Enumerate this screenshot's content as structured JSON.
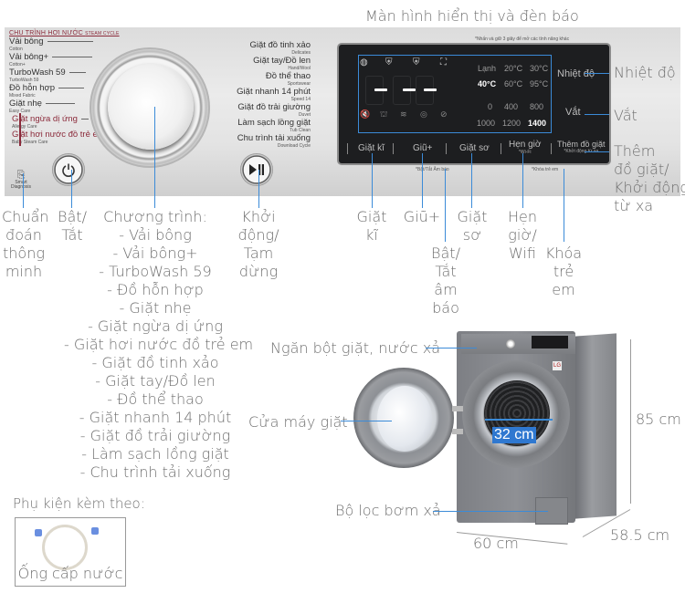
{
  "title_display": "Màn hình hiển thị và đèn báo",
  "panel": {
    "program_header": "CHU TRÌNH HƠI NƯỚC",
    "program_header_sub": "STEAM CYCLE",
    "left_programs": [
      {
        "name": "Vải bông",
        "sub": "Cotton",
        "style": "normal"
      },
      {
        "name": "Vải bông+",
        "sub": "Cotton+",
        "style": "normal"
      },
      {
        "name": "TurboWash 59",
        "sub": "TurboWash 59",
        "style": "normal"
      },
      {
        "name": "Đồ hỗn hợp",
        "sub": "Mixed Fabric",
        "style": "normal"
      },
      {
        "name": "Giặt nhẹ",
        "sub": "Easy Care",
        "style": "normal"
      },
      {
        "name": "Giặt ngừa dị ứng",
        "sub": "Allergy Care",
        "style": "red"
      },
      {
        "name": "Giặt hơi nước đồ trẻ em",
        "sub": "Baby Steam Care",
        "style": "red"
      }
    ],
    "right_programs": [
      {
        "name": "Giặt đồ tinh xảo",
        "sub": "Delicates"
      },
      {
        "name": "Giặt tay/Đồ len",
        "sub": "Hand/Wool"
      },
      {
        "name": "Đồ thể thao",
        "sub": "Sportswear"
      },
      {
        "name": "Giặt nhanh 14 phút",
        "sub": "Speed 14"
      },
      {
        "name": "Giặt đồ trải giường",
        "sub": "Duvet"
      },
      {
        "name": "Làm sạch lồng giặt",
        "sub": "Tub Clean"
      },
      {
        "name": "Chu trình tải xuống",
        "sub": "Download Cycle"
      }
    ],
    "smart_diagnosis": "Smart Diagnosis",
    "display_note": "*Nhấn và giữ 3 giây để mở các tính năng khác",
    "time_readout": "-:--",
    "temperatures": [
      "Lạnh",
      "20°C",
      "30°C",
      "40°C",
      "60°C",
      "95°C"
    ],
    "temperature_selected": "40°C",
    "spins": [
      "0",
      "400",
      "800",
      "1000",
      "1200",
      "1400"
    ],
    "spin_selected": "1400",
    "side_labels": {
      "temp": "Nhiệt độ",
      "spin": "Vắt"
    },
    "buttons": [
      {
        "label": "Giặt kĩ",
        "sub": ""
      },
      {
        "label": "Giũ+",
        "sub": ""
      },
      {
        "label": "Giặt sơ",
        "sub": ""
      },
      {
        "label": "Hẹn giờ",
        "sub": "*Wi-Fi"
      },
      {
        "label": "Thêm đồ giặt",
        "sub": "*Khởi động từ xa"
      }
    ],
    "under_notes": {
      "sound": "*Bật/Tắt Âm báo",
      "lock": "*Khóa trẻ em"
    }
  },
  "callouts": {
    "smart_diag": [
      "Chuẩn",
      "đoán",
      "thông",
      "minh"
    ],
    "power": [
      "Bật/",
      "Tắt"
    ],
    "programs_title": "Chương trình:",
    "programs_list": [
      "- Vải bông",
      "- Vải bông+",
      "- TurboWash 59",
      "- Đồ hỗn hợp",
      "- Giặt nhẹ",
      "- Giặt ngừa dị ứng",
      "- Giặt hơi nước đồ trẻ em",
      "- Giặt đồ tinh xảo",
      "- Giặt tay/Đồ len",
      "- Đồ thể thao",
      "- Giặt nhanh 14 phút",
      "- Giặt đồ trải giường",
      "- Làm sạch lồng giặt",
      "- Chu trình tải xuống"
    ],
    "start": [
      "Khởi",
      "động/",
      "Tạm",
      "dừng"
    ],
    "intensive": [
      "Giặt",
      "kĩ"
    ],
    "rinse": [
      "Giũ+"
    ],
    "prewash": [
      "Giặt",
      "sơ"
    ],
    "sound": [
      "Bật/",
      "Tắt",
      "âm",
      "báo"
    ],
    "timer": [
      "Hẹn",
      "giờ/",
      "Wifi"
    ],
    "childlock": [
      "Khóa",
      "trẻ",
      "em"
    ],
    "temp": "Nhiệt độ",
    "spin": "Vắt",
    "add_item": [
      "Thêm",
      "đồ giặt/",
      "Khởi động",
      "từ xa"
    ]
  },
  "washer": {
    "detergent": "Ngăn bột giặt, nước xả",
    "door": "Cửa máy giặt",
    "filter": "Bộ lọc bơm xả",
    "door_diameter": "32 cm",
    "height": "85 cm",
    "width": "60 cm",
    "depth": "58.5 cm"
  },
  "accessory": {
    "title": "Phụ kiện kèm theo:",
    "item": "Ống cấp nước"
  },
  "colors": {
    "accent_line": "#3b8bd8",
    "label_badge": "#2f78d0",
    "program_red": "#8b2a3a"
  }
}
